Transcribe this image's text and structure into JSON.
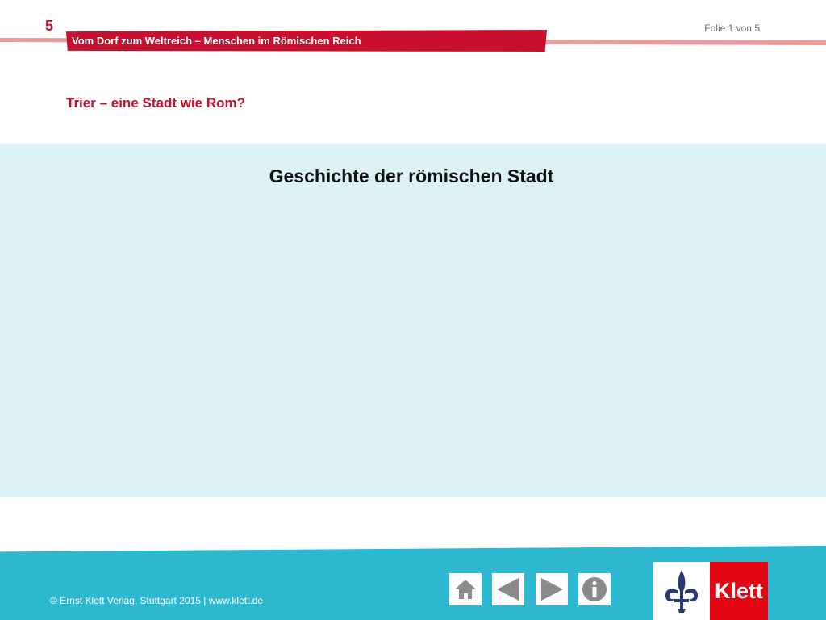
{
  "header": {
    "chapter_number": "5",
    "banner_title": "Vom Dorf zum Weltreich – Menschen im Römischen Reich",
    "slide_counter": "Folie 1 von 5"
  },
  "subtitle": "Trier – eine Stadt wie Rom?",
  "content": {
    "heading": "Geschichte der römischen Stadt"
  },
  "footer": {
    "copyright": "© Ernst Klett Verlag, Stuttgart 2015 | www.klett.de",
    "nav": {
      "home_icon": "home-icon",
      "prev_icon": "triangle-left-icon",
      "next_icon": "triangle-right-icon",
      "info_icon": "info-icon"
    },
    "logo_text": "Klett"
  },
  "colors": {
    "brand_red": "#c8102e",
    "panel_bg": "#dcf2f6",
    "footer_bg": "#2db8cf",
    "icon_grey": "#8a8a8a",
    "logo_red": "#e30613",
    "logo_navy": "#2a3a78"
  }
}
